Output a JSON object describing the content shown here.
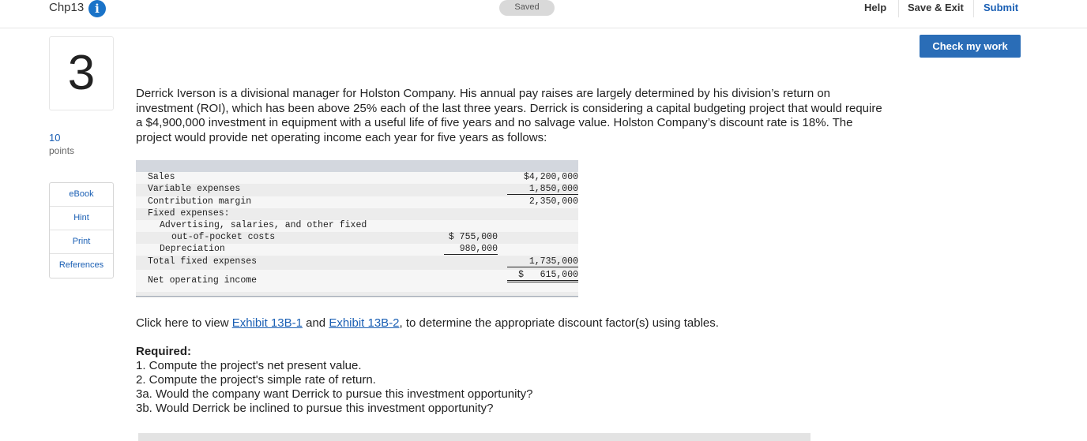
{
  "header": {
    "chapter": "Chp13",
    "info_icon": "i",
    "saved_label": "Saved",
    "help_label": "Help",
    "save_exit_label": "Save & Exit",
    "submit_label": "Submit",
    "check_label": "Check my work"
  },
  "question_meta": {
    "number": "3",
    "points_value": "10",
    "points_label": "points"
  },
  "sidebar": {
    "items": [
      {
        "label": "eBook"
      },
      {
        "label": "Hint"
      },
      {
        "label": "Print"
      },
      {
        "label": "References"
      }
    ]
  },
  "question": {
    "text": "Derrick Iverson is a divisional manager for Holston Company. His annual pay raises are largely determined by his division’s return on investment (ROI), which has been above 25% each of the last three years. Derrick is considering a capital budgeting project that would require a $4,900,000 investment in equipment with a useful life of five years and no salvage value. Holston Company’s discount rate is 18%. The project would provide net operating income each year for five years as follows:"
  },
  "income_table": {
    "rows": [
      {
        "label": "Sales",
        "col1": "",
        "col2": "$4,200,000"
      },
      {
        "label": "Variable expenses",
        "col1": "",
        "col2": "1,850,000"
      },
      {
        "label": "Contribution margin",
        "col1": "",
        "col2": "2,350,000"
      },
      {
        "label": "Fixed expenses:",
        "col1": "",
        "col2": ""
      },
      {
        "label": "Advertising, salaries, and other fixed",
        "col1": "",
        "col2": ""
      },
      {
        "label": "out-of-pocket costs",
        "col1": "$ 755,000",
        "col2": ""
      },
      {
        "label": "Depreciation",
        "col1": "980,000",
        "col2": ""
      },
      {
        "label": "Total fixed expenses",
        "col1": "",
        "col2": "1,735,000"
      },
      {
        "label": "Net operating income",
        "col1": "",
        "col2": "$   615,000"
      }
    ]
  },
  "exhibit": {
    "prefix": "Click here to view ",
    "link1": "Exhibit 13B-1",
    "middle": " and ",
    "link2": "Exhibit 13B-2",
    "suffix": ", to determine the appropriate discount factor(s) using tables."
  },
  "required": {
    "title": "Required:",
    "items": [
      "1. Compute the project's net present value.",
      "2. Compute the project's simple rate of return.",
      "3a. Would the company want Derrick to pursue this investment opportunity?",
      "3b. Would Derrick be inclined to pursue this investment opportunity?"
    ]
  }
}
